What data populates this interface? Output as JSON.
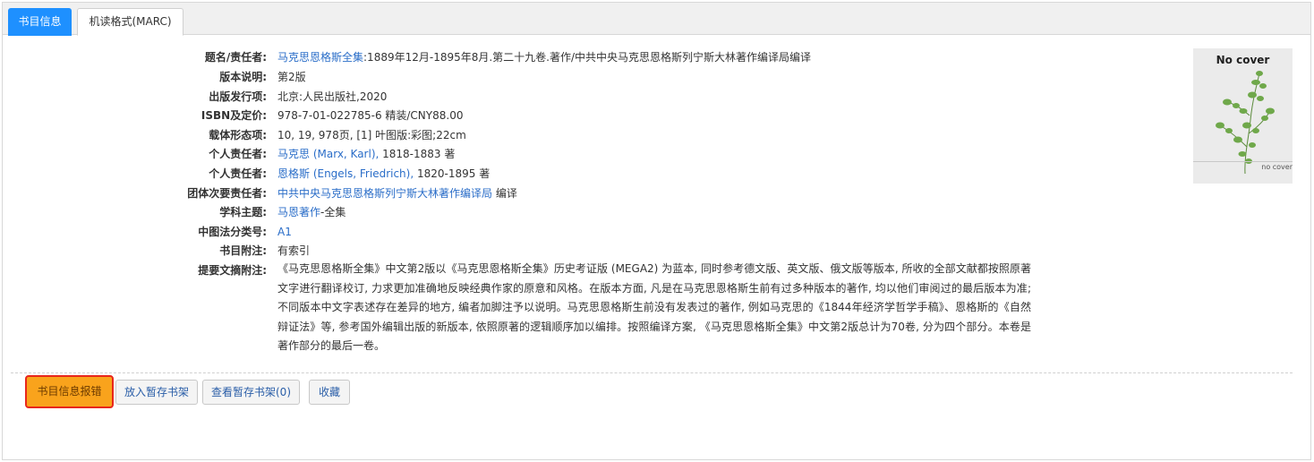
{
  "tabs": [
    {
      "label": "书目信息"
    },
    {
      "label": "机读格式(MARC)"
    }
  ],
  "record": {
    "title": {
      "label": "题名/责任者:",
      "link": "马克思恩格斯全集",
      "rest": ":1889年12月-1895年8月.第二十九卷.著作/中共中央马克思恩格斯列宁斯大林著作编译局编译"
    },
    "edition": {
      "label": "版本说明:",
      "value": "第2版"
    },
    "publication": {
      "label": "出版发行项:",
      "value": "北京:人民出版社,2020"
    },
    "isbn": {
      "label": "ISBN及定价:",
      "value": "978-7-01-022785-6 精装/CNY88.00"
    },
    "physical": {
      "label": "载体形态项:",
      "value": "10, 19, 978页, [1] 叶图版:彩图;22cm"
    },
    "author1": {
      "label": "个人责任者:",
      "link": "马克思 (Marx, Karl),",
      "rest": " 1818-1883 著"
    },
    "author2": {
      "label": "个人责任者:",
      "link": "恩格斯 (Engels, Friedrich),",
      "rest": " 1820-1895 著"
    },
    "corporate": {
      "label": "团体次要责任者:",
      "link": "中共中央马克思恩格斯列宁斯大林著作编译局",
      "rest": " 编译"
    },
    "subject": {
      "label": "学科主题:",
      "link": "马恩著作",
      "rest": "-全集"
    },
    "clc": {
      "label": "中图法分类号:",
      "link": "A1"
    },
    "note": {
      "label": "书目附注:",
      "value": "有索引"
    },
    "abstract": {
      "label": "提要文摘附注:",
      "value": "《马克思恩格斯全集》中文第2版以《马克思恩格斯全集》历史考证版 (MEGA2) 为蓝本, 同时参考德文版、英文版、俄文版等版本, 所收的全部文献都按照原著文字进行翻译校订, 力求更加准确地反映经典作家的原意和风格。在版本方面, 凡是在马克思恩格斯生前有过多种版本的著作, 均以他们审阅过的最后版本为准; 不同版本中文字表述存在差异的地方, 编者加脚注予以说明。马克思恩格斯生前没有发表过的著作, 例如马克思的《1844年经济学哲学手稿》、恩格斯的《自然辩证法》等, 参考国外编辑出版的新版本, 依照原著的逻辑顺序加以编排。按照编译方案, 《马克思恩格斯全集》中文第2版总计为70卷, 分为四个部分。本卷是著作部分的最后一卷。"
    }
  },
  "cover": {
    "title": "No cover",
    "footer": "no cover"
  },
  "actions": {
    "report": "书目信息报错",
    "add_shelf": "放入暂存书架",
    "view_shelf": "查看暂存书架(0)",
    "favorite": "收藏"
  },
  "colors": {
    "accent": "#1e90ff",
    "link": "#2a6dc8",
    "report_bg": "#f9a31c",
    "report_border": "#e8271c"
  }
}
